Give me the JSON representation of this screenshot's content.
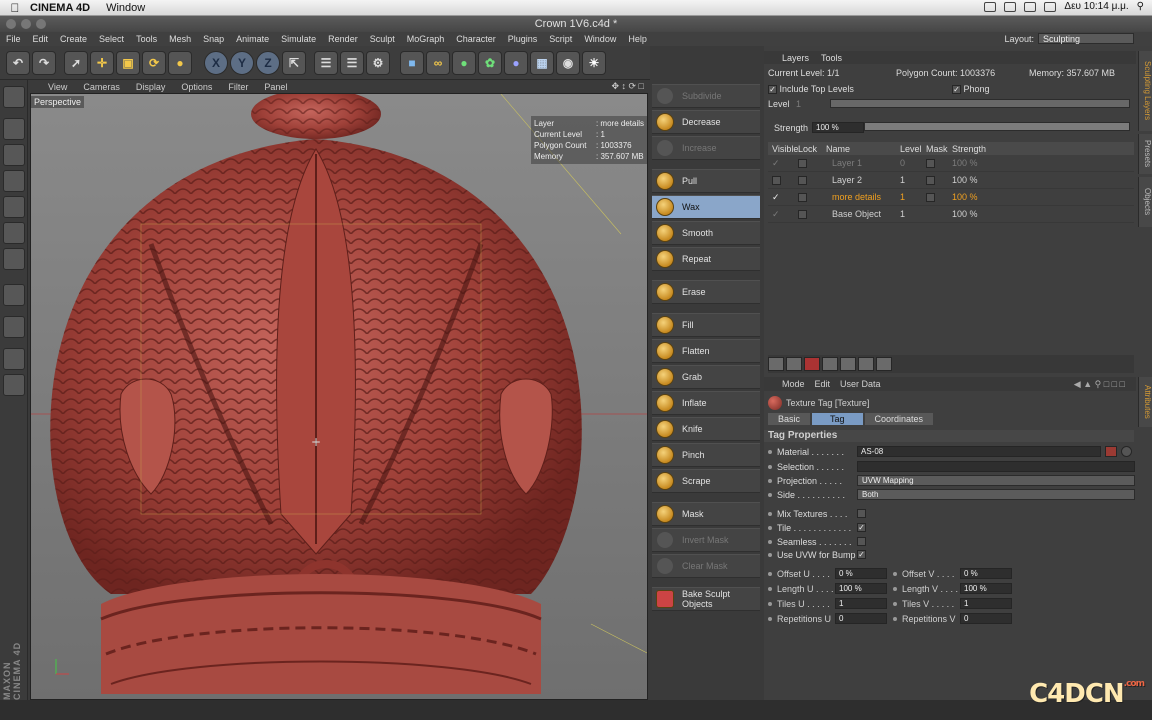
{
  "macbar": {
    "app_name": "CINEMA 4D",
    "menu_window": "Window",
    "clock": "Δευ 10:14 μ.μ."
  },
  "window": {
    "title": "Crown 1V6.c4d *"
  },
  "menu": [
    "File",
    "Edit",
    "Create",
    "Select",
    "Tools",
    "Mesh",
    "Snap",
    "Animate",
    "Simulate",
    "Render",
    "Sculpt",
    "MoGraph",
    "Character",
    "Plugins",
    "Script",
    "Window",
    "Help"
  ],
  "layout": {
    "label": "Layout:",
    "value": "Sculpting"
  },
  "toolbar": {
    "axis_x": "X",
    "axis_y": "Y",
    "axis_z": "Z"
  },
  "viewport": {
    "menu": [
      "View",
      "Cameras",
      "Display",
      "Options",
      "Filter",
      "Panel"
    ],
    "camera": "Perspective",
    "hud": [
      {
        "k": "Layer",
        "v": ": more details"
      },
      {
        "k": "Current Level",
        "v": ": 1"
      },
      {
        "k": "Polygon Count",
        "v": ": 1003376"
      },
      {
        "k": "Memory",
        "v": ": 357.607 MB"
      }
    ],
    "logo": "MAXON CINEMA 4D"
  },
  "tools": [
    {
      "label": "Subdivide",
      "state": "disabled"
    },
    {
      "label": "Decrease",
      "state": "normal"
    },
    {
      "label": "Increase",
      "state": "disabled"
    },
    {
      "label": "Pull",
      "state": "normal"
    },
    {
      "label": "Wax",
      "state": "active"
    },
    {
      "label": "Smooth",
      "state": "normal"
    },
    {
      "label": "Repeat",
      "state": "normal"
    },
    {
      "label": "Erase",
      "state": "normal"
    },
    {
      "label": "Fill",
      "state": "normal"
    },
    {
      "label": "Flatten",
      "state": "normal"
    },
    {
      "label": "Grab",
      "state": "normal"
    },
    {
      "label": "Inflate",
      "state": "normal"
    },
    {
      "label": "Knife",
      "state": "normal"
    },
    {
      "label": "Pinch",
      "state": "normal"
    },
    {
      "label": "Scrape",
      "state": "normal"
    },
    {
      "label": "Mask",
      "state": "normal"
    },
    {
      "label": "Invert Mask",
      "state": "disabled"
    },
    {
      "label": "Clear Mask",
      "state": "disabled"
    },
    {
      "label": "Bake Sculpt Objects",
      "state": "normal"
    }
  ],
  "layers_panel": {
    "menu": [
      "Layers",
      "Tools"
    ],
    "current_level": "Current Level: 1/1",
    "polygon_count": "Polygon Count: 1003376",
    "memory": "Memory: 357.607 MB",
    "include_top_levels": "Include Top Levels",
    "phong": "Phong",
    "level_label": "Level",
    "level_value": "1",
    "strength_label": "Strength",
    "strength_value": "100 %",
    "columns": [
      "Visible",
      "Lock",
      "Name",
      "Level",
      "Mask",
      "Strength"
    ],
    "rows": [
      {
        "visible": "✓",
        "name": "Layer 1",
        "level": "0",
        "strength": "100 %",
        "style": "dim"
      },
      {
        "visible": "",
        "name": "Layer 2",
        "level": "1",
        "strength": "100 %",
        "style": ""
      },
      {
        "visible": "✓",
        "name": "more details",
        "level": "1",
        "strength": "100 %",
        "style": "hl"
      },
      {
        "visible": "✓",
        "name": "Base Object",
        "level": "1",
        "strength": "100 %",
        "style": ""
      }
    ],
    "side_tabs": [
      "Sculpting Layers",
      "Presets",
      "Objects"
    ]
  },
  "attributes": {
    "menu": [
      "Mode",
      "Edit",
      "User Data"
    ],
    "title": "Texture Tag [Texture]",
    "tabs": [
      "Basic",
      "Tag",
      "Coordinates"
    ],
    "section": "Tag Properties",
    "material_label": "Material . . . . . . .",
    "material_value": "AS-08",
    "selection_label": "Selection . . . . . .",
    "projection_label": "Projection . . . . .",
    "projection_value": "UVW Mapping",
    "side_label": "Side . . . . . . . . . .",
    "side_value": "Both",
    "mix_textures": "Mix Textures . . . .",
    "tile": "Tile . . . . . . . . . . . .",
    "seamless": "Seamless . . . . . . .",
    "use_uvw": "Use UVW for Bump",
    "offset_u": "Offset U . . . .",
    "offset_u_val": "0 %",
    "offset_v": "Offset V . . . .",
    "offset_v_val": "0 %",
    "length_u": "Length U . . . .",
    "length_u_val": "100 %",
    "length_v": "Length V . . . .",
    "length_v_val": "100 %",
    "tiles_u": "Tiles U . . . . .",
    "tiles_u_val": "1",
    "tiles_v": "Tiles V . . . . .",
    "tiles_v_val": "1",
    "rep_u": "Repetitions U",
    "rep_u_val": "0",
    "rep_v": "Repetitions V",
    "rep_v_val": "0",
    "side_tab": "Attributes"
  },
  "watermark": {
    "text": "C4DCN",
    "tag": ".com"
  }
}
